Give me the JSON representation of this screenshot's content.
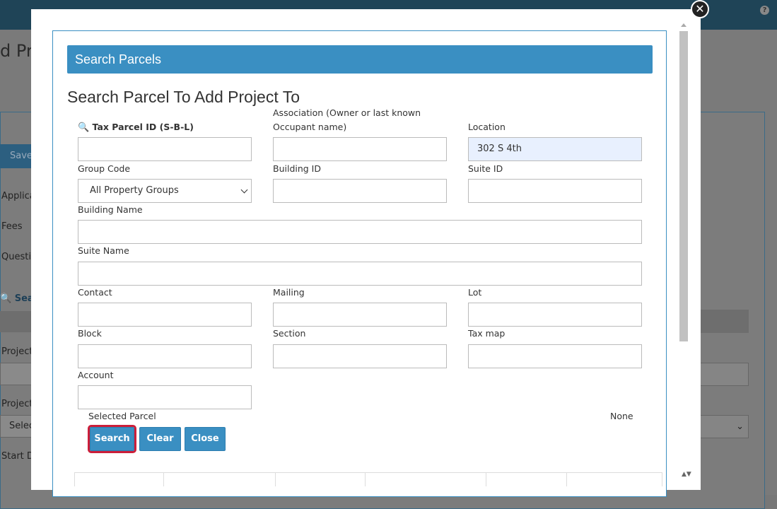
{
  "background": {
    "title_fragment": "d Pr",
    "save_label": "Save",
    "side_items": [
      "Applica",
      "Fees",
      "Questio"
    ],
    "search_link": "Sea",
    "labels": [
      "Project a",
      "Project N",
      "Start Da"
    ],
    "select_fragment": "Selec"
  },
  "modal": {
    "close_glyph": "✕",
    "header": "Search Parcels",
    "title": "Search Parcel To Add Project To",
    "fields": {
      "tax_parcel_label": "Tax Parcel ID (S-B-L)",
      "association_label_line1": "Association (Owner or last known",
      "association_label_line2": "Occupant name)",
      "location_label": "Location",
      "location_value": "302 S 4th",
      "group_code_label": "Group Code",
      "group_code_value": "All Property Groups",
      "building_id_label": "Building ID",
      "suite_id_label": "Suite ID",
      "building_name_label": "Building Name",
      "suite_name_label": "Suite Name",
      "contact_label": "Contact",
      "mailing_label": "Mailing",
      "lot_label": "Lot",
      "block_label": "Block",
      "section_label": "Section",
      "tax_map_label": "Tax map",
      "account_label": "Account"
    },
    "selected_parcel_label": "Selected Parcel",
    "selected_parcel_value": "None",
    "buttons": {
      "search": "Search",
      "clear": "Clear",
      "close": "Close"
    }
  },
  "colors": {
    "accent": "#3a8fc2",
    "focus_outline": "#cc1e3a",
    "autofill": "#e8f0fe"
  }
}
